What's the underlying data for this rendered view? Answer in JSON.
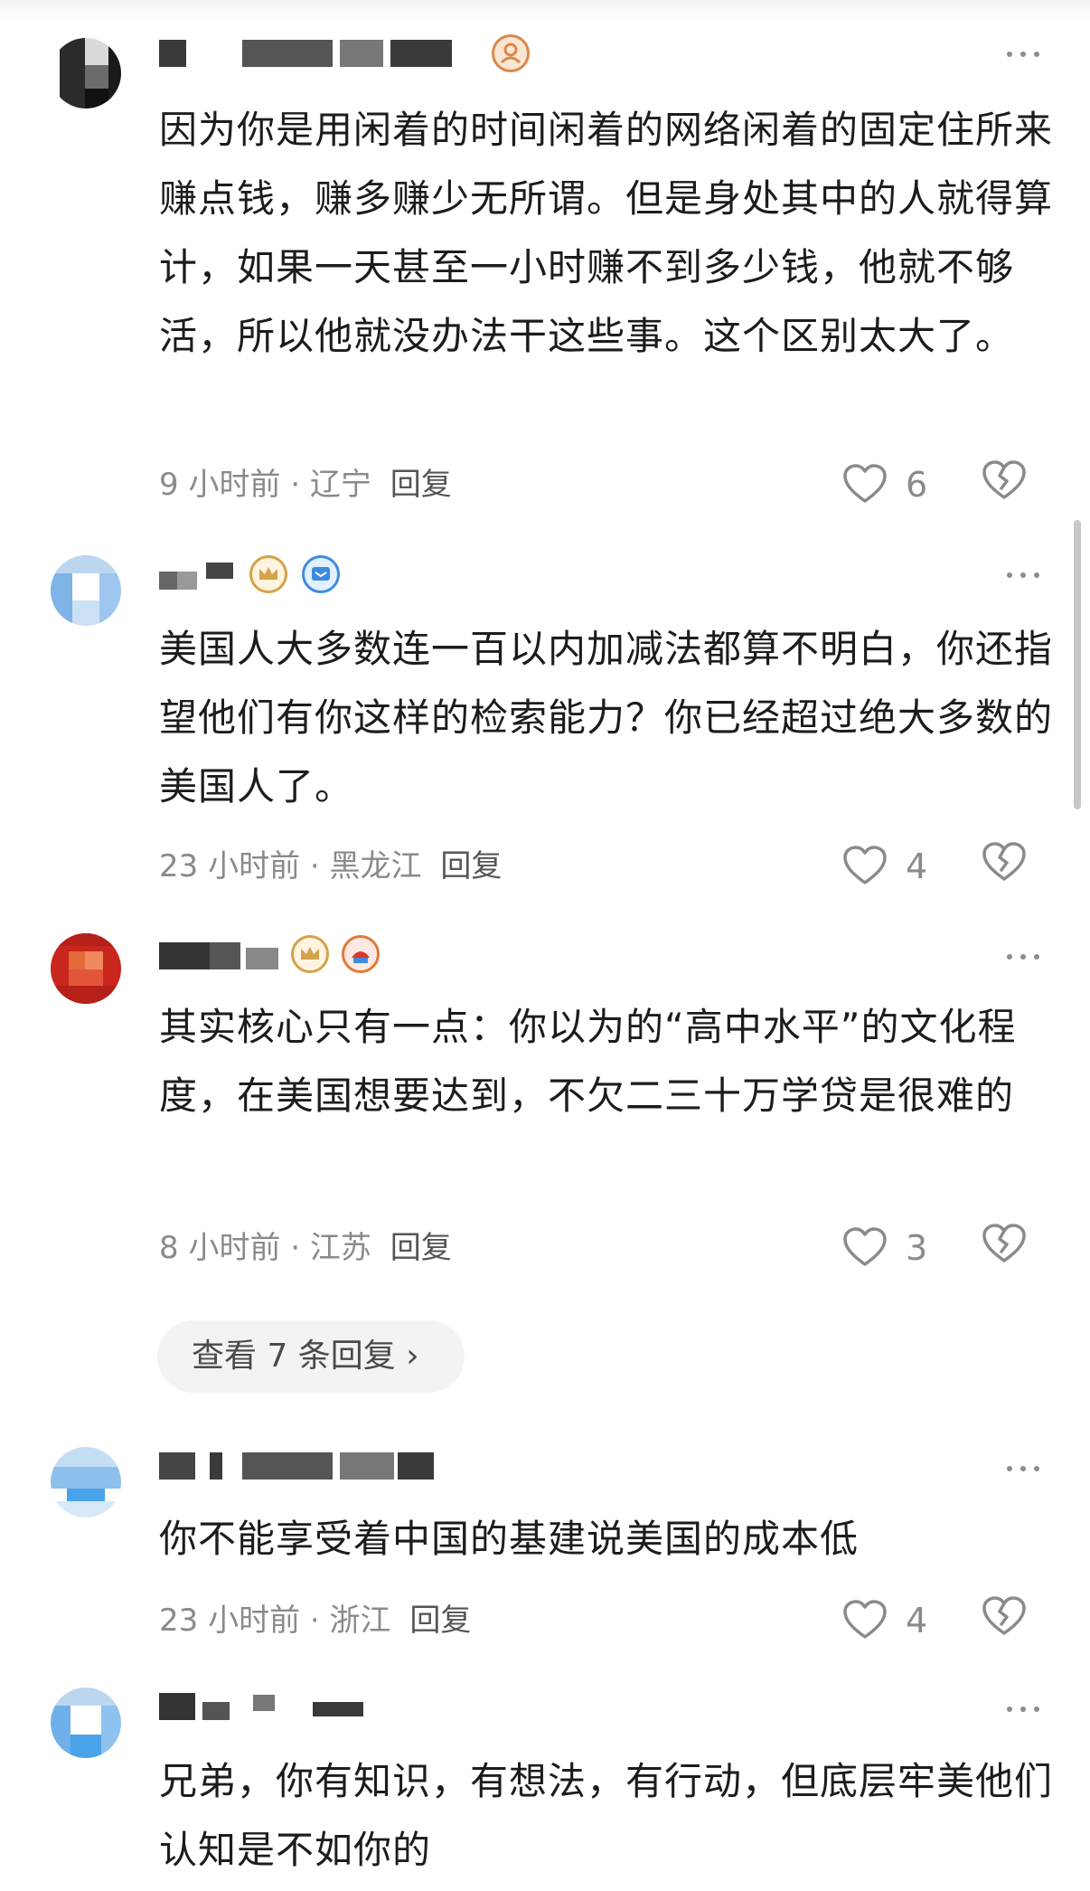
{
  "comments": [
    {
      "text": "因为你是用闲着的时间闲着的网络闲着的固定住所来赚点钱，赚多赚少无所谓。但是身处其中的人就得算计，如果一天甚至一小时赚不到多少钱，他就不够活，所以他就没办法干这些事。这个区别太大了。",
      "time": "9 小时前",
      "sep": "·",
      "location": "辽宁",
      "reply_label": "回复",
      "likes": "6"
    },
    {
      "text": "美国人大多数连一百以内加减法都算不明白，你还指望他们有你这样的检索能力？你已经超过绝大多数的美国人了。",
      "time": "23 小时前",
      "sep": "·",
      "location": "黑龙江",
      "reply_label": "回复",
      "likes": "4"
    },
    {
      "text": "其实核心只有一点：你以为的“高中水平”的文化程度，在美国想要达到，不欠二三十万学贷是很难的",
      "time": "8 小时前",
      "sep": "·",
      "location": "江苏",
      "reply_label": "回复",
      "likes": "3",
      "view_replies": "查看 7 条回复 ›"
    },
    {
      "text": "你不能享受着中国的基建说美国的成本低",
      "time": "23 小时前",
      "sep": "·",
      "location": "浙江",
      "reply_label": "回复",
      "likes": "4"
    },
    {
      "text": "兄弟，你有知识，有想法，有行动，但底层牢美他们认知是不如你的"
    }
  ],
  "icons": {
    "like": "heart-outline-icon",
    "dislike": "broken-heart-icon",
    "more": "more-dots-icon"
  },
  "colors": {
    "text": "#1c1c1c",
    "meta": "#8a8a8a",
    "badge_gold": "#d4a24a",
    "badge_blue": "#3d8be0",
    "badge_orange": "#e07a3a"
  }
}
